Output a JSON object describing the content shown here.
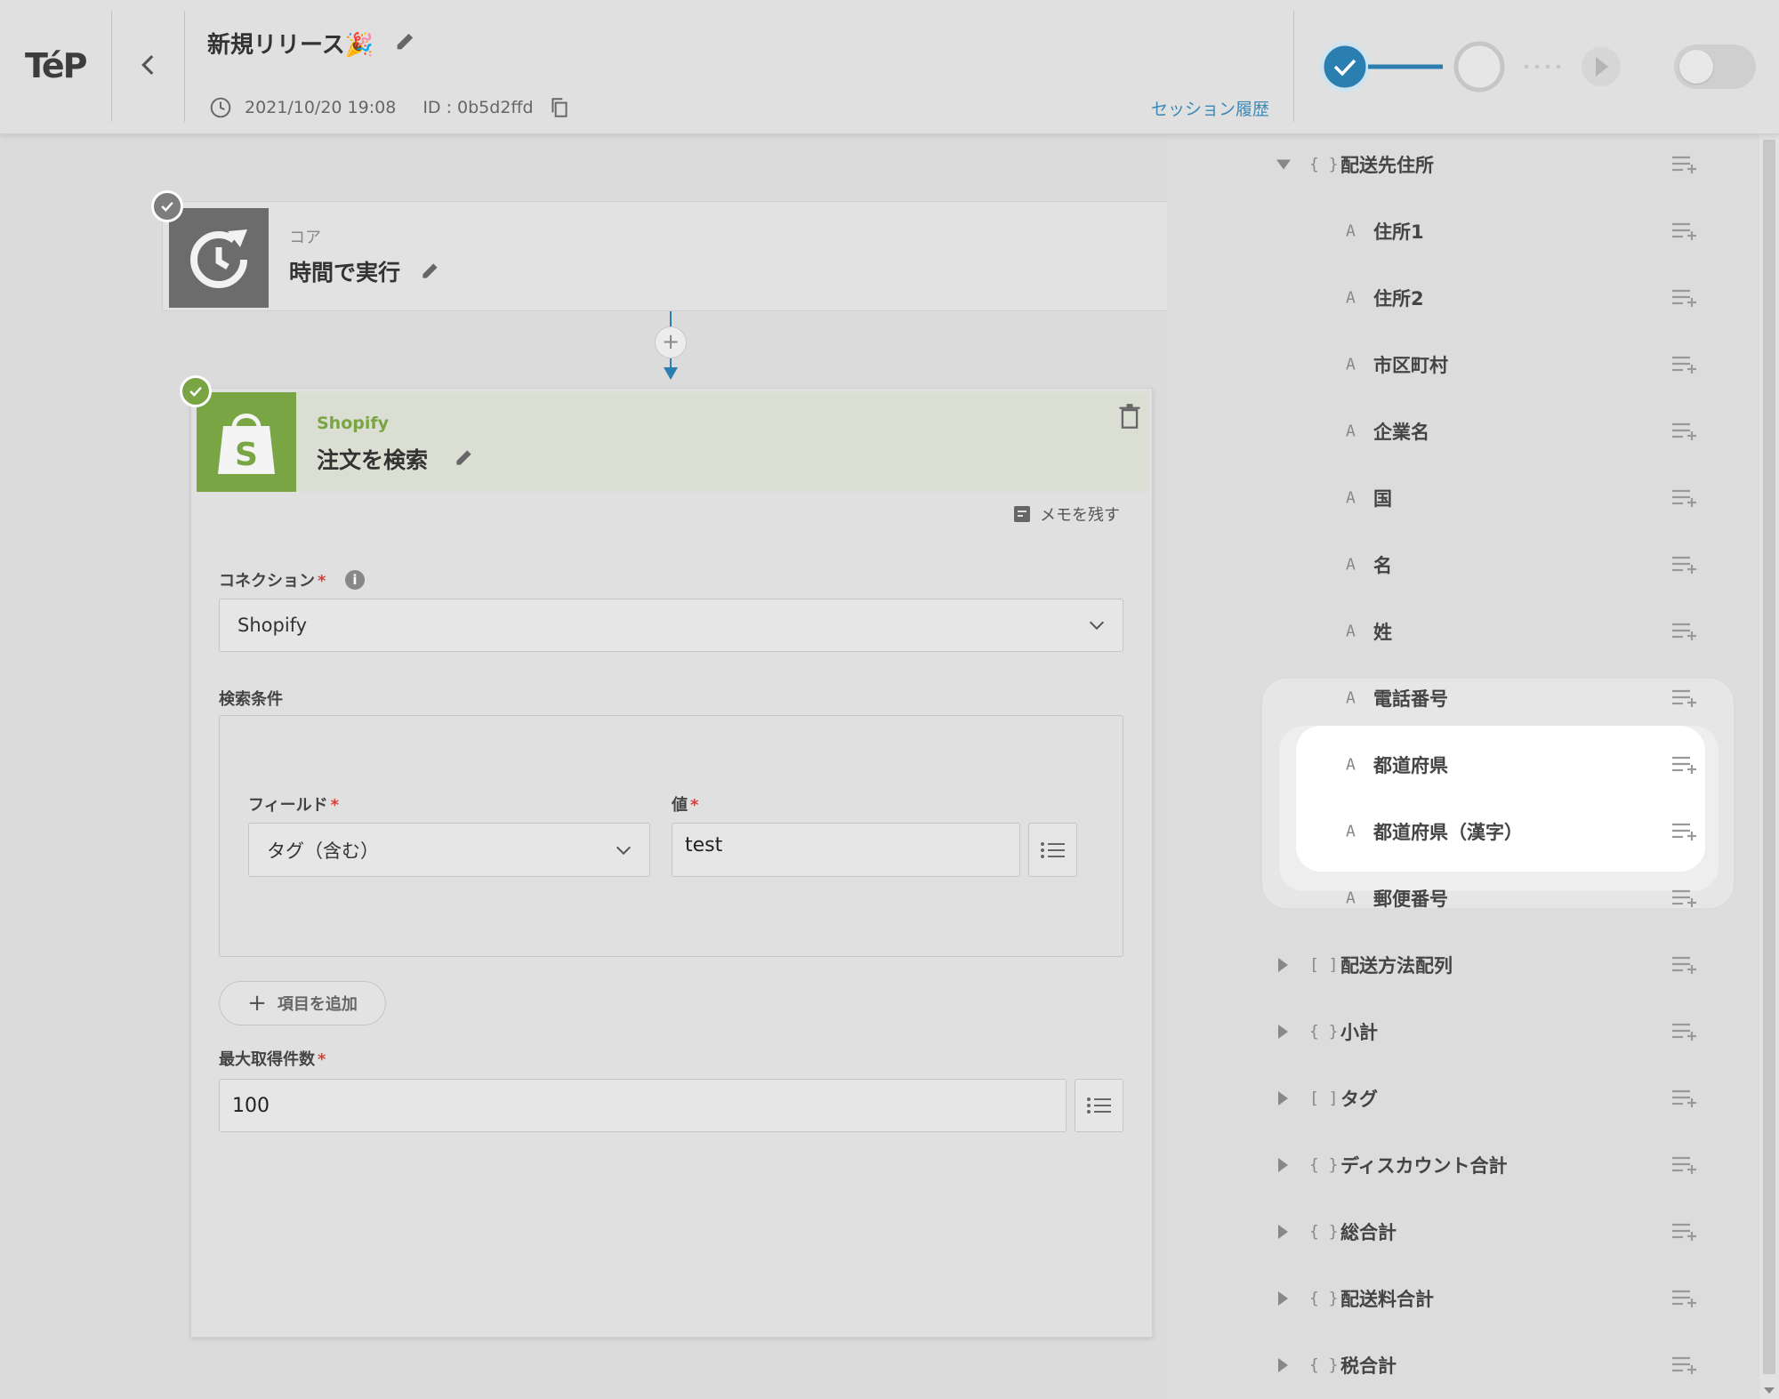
{
  "header": {
    "logo": "TéP",
    "flow_title": "新規リリース🎉",
    "datetime": "2021/10/20 19:08",
    "id_text": "ID : 0b5d2ffd",
    "session_history": "セッション履歴"
  },
  "colors": {
    "accent": "#2a7fb0",
    "shopify_green": "#7aa544",
    "required": "#d2413b",
    "link": "#3a8ab5"
  },
  "step1": {
    "category": "コア",
    "name": "時間で実行",
    "icon": "clock-refresh-icon"
  },
  "step2": {
    "category": "Shopify",
    "name": "注文を検索",
    "icon": "shopify-bag-icon",
    "memo": "メモを残す",
    "connection_label": "コネクション",
    "connection_value": "Shopify",
    "search_label": "検索条件",
    "field_label": "フィールド",
    "field_value": "タグ（含む）",
    "value_label": "値",
    "value_value": "test",
    "add_item": "項目を追加",
    "max_label": "最大取得件数",
    "max_value": "100",
    "required_mark": "*",
    "info_mark": "i",
    "plus_mark": "+"
  },
  "tree": {
    "items": [
      {
        "label": "配送先住所",
        "type": "{ }",
        "toggle": "down",
        "level": 0
      },
      {
        "label": "住所1",
        "type": "A",
        "level": 1
      },
      {
        "label": "住所2",
        "type": "A",
        "level": 1
      },
      {
        "label": "市区町村",
        "type": "A",
        "level": 1
      },
      {
        "label": "企業名",
        "type": "A",
        "level": 1
      },
      {
        "label": "国",
        "type": "A",
        "level": 1
      },
      {
        "label": "名",
        "type": "A",
        "level": 1
      },
      {
        "label": "姓",
        "type": "A",
        "level": 1
      },
      {
        "label": "電話番号",
        "type": "A",
        "level": 1
      },
      {
        "label": "都道府県",
        "type": "A",
        "level": 1
      },
      {
        "label": "都道府県（漢字）",
        "type": "A",
        "level": 1
      },
      {
        "label": "郵便番号",
        "type": "A",
        "level": 1
      },
      {
        "label": "配送方法配列",
        "type": "[ ]",
        "toggle": "right",
        "level": 0
      },
      {
        "label": "小計",
        "type": "{ }",
        "toggle": "right",
        "level": 0
      },
      {
        "label": "タグ",
        "type": "[ ]",
        "toggle": "right",
        "level": 0
      },
      {
        "label": "ディスカウント合計",
        "type": "{ }",
        "toggle": "right",
        "level": 0
      },
      {
        "label": "総合計",
        "type": "{ }",
        "toggle": "right",
        "level": 0
      },
      {
        "label": "配送料合計",
        "type": "{ }",
        "toggle": "right",
        "level": 0
      },
      {
        "label": "税合計",
        "type": "{ }",
        "toggle": "right",
        "level": 0
      }
    ]
  }
}
